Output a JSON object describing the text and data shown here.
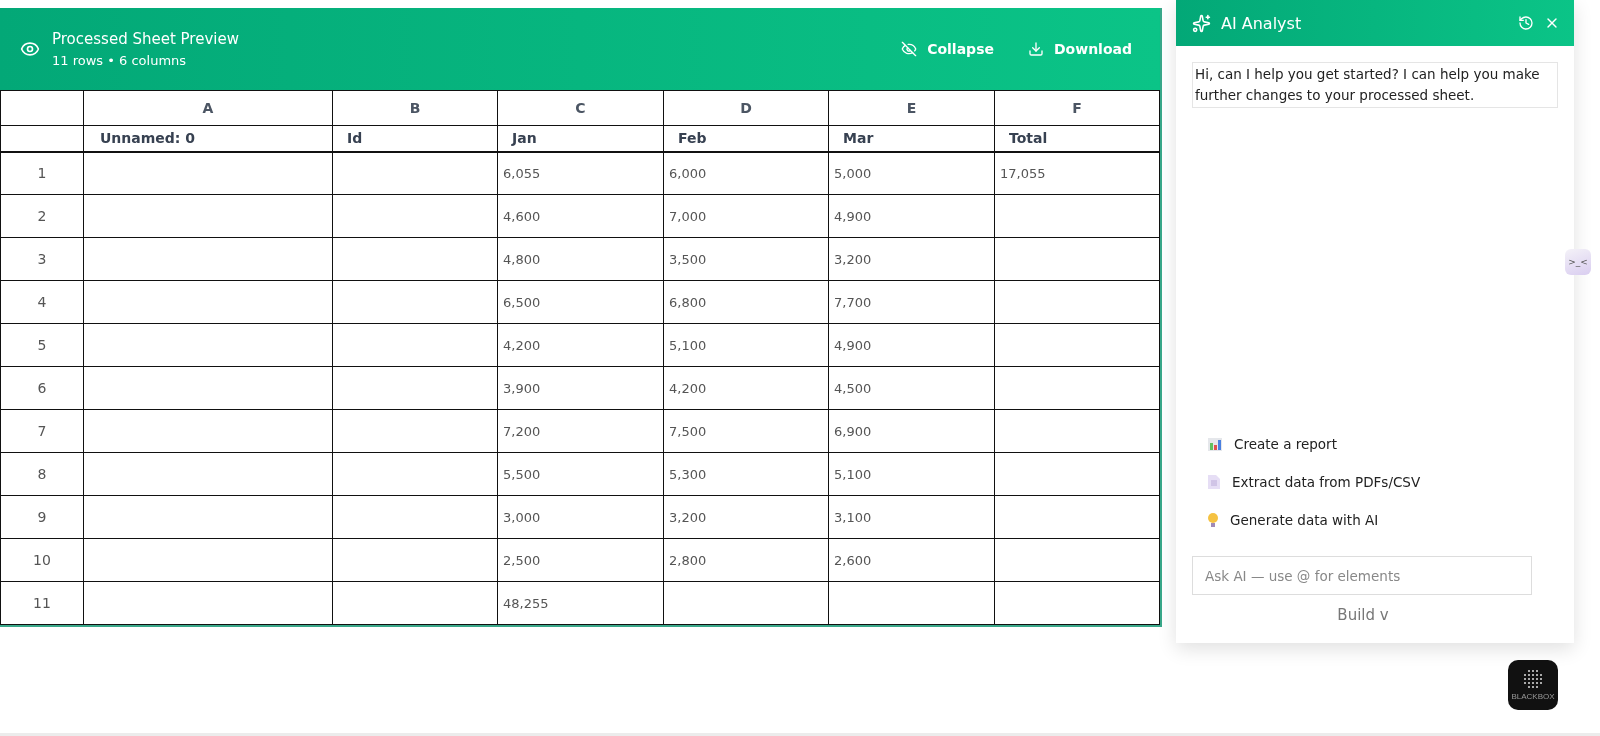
{
  "sheet": {
    "title": "Processed Sheet Preview",
    "subtitle": "11 rows • 6 columns",
    "actions": [
      {
        "kind": "collapse",
        "label": "Collapse"
      },
      {
        "kind": "download",
        "label": "Download"
      }
    ],
    "column_letters": [
      "A",
      "B",
      "C",
      "D",
      "E",
      "F"
    ],
    "column_names": [
      "Unnamed: 0",
      "Id",
      "Jan",
      "Feb",
      "Mar",
      "Total"
    ],
    "rows": [
      {
        "number": "1",
        "cells": [
          "",
          "",
          "6,055",
          "6,000",
          "5,000",
          "17,055"
        ]
      },
      {
        "number": "2",
        "cells": [
          "",
          "",
          "4,600",
          "7,000",
          "4,900",
          ""
        ]
      },
      {
        "number": "3",
        "cells": [
          "",
          "",
          "4,800",
          "3,500",
          "3,200",
          ""
        ]
      },
      {
        "number": "4",
        "cells": [
          "",
          "",
          "6,500",
          "6,800",
          "7,700",
          ""
        ]
      },
      {
        "number": "5",
        "cells": [
          "",
          "",
          "4,200",
          "5,100",
          "4,900",
          ""
        ]
      },
      {
        "number": "6",
        "cells": [
          "",
          "",
          "3,900",
          "4,200",
          "4,500",
          ""
        ]
      },
      {
        "number": "7",
        "cells": [
          "",
          "",
          "7,200",
          "7,500",
          "6,900",
          ""
        ]
      },
      {
        "number": "8",
        "cells": [
          "",
          "",
          "5,500",
          "5,300",
          "5,100",
          ""
        ]
      },
      {
        "number": "9",
        "cells": [
          "",
          "",
          "3,000",
          "3,200",
          "3,100",
          ""
        ]
      },
      {
        "number": "10",
        "cells": [
          "",
          "",
          "2,500",
          "2,800",
          "2,600",
          ""
        ]
      },
      {
        "number": "11",
        "cells": [
          "",
          "",
          "48,255",
          "",
          "",
          ""
        ]
      }
    ]
  },
  "assistant": {
    "title": "AI Analyst",
    "message": "Hi, can I help you get started? I can help you make further changes to your processed sheet.",
    "suggestions": [
      {
        "kind": "report",
        "label": "Create a report"
      },
      {
        "kind": "document",
        "label": "Extract data from PDFs/CSV"
      },
      {
        "kind": "idea",
        "label": "Generate data with AI"
      }
    ],
    "input": {
      "placeholder": "Ask AI — use @ for elements"
    },
    "mode": "Build v"
  },
  "side_tab": {
    "label": ">_<"
  },
  "launcher": {
    "label": "BLACKBOX"
  }
}
